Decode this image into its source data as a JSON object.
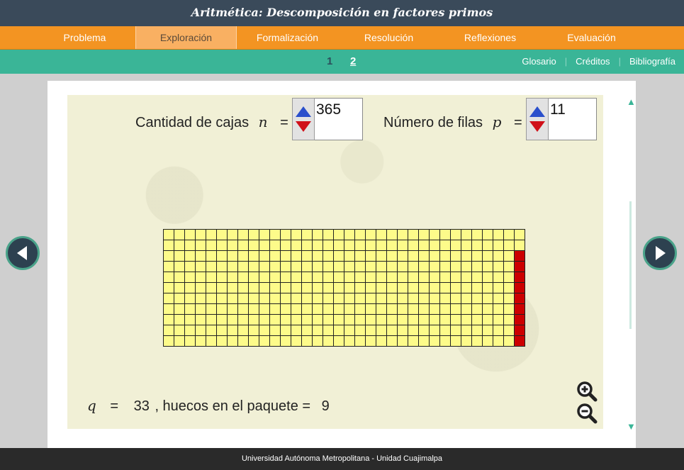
{
  "header": {
    "title": "Aritmética: Descomposición en factores primos"
  },
  "main_nav": {
    "tabs": [
      {
        "label": "Problema",
        "active": false
      },
      {
        "label": "Exploración",
        "active": true
      },
      {
        "label": "Formalización",
        "active": false
      },
      {
        "label": "Resolución",
        "active": false
      },
      {
        "label": "Reflexiones",
        "active": false
      },
      {
        "label": "Evaluación",
        "active": false
      }
    ]
  },
  "sub_nav": {
    "pages": [
      {
        "label": "1",
        "current": false
      },
      {
        "label": "2",
        "current": true
      }
    ],
    "links": [
      "Glosario",
      "Créditos",
      "Bibliografía"
    ]
  },
  "exploration": {
    "n_label": "Cantidad de cajas",
    "n_var": "n",
    "n_value": "365",
    "p_label": "Número de filas",
    "p_var": "p",
    "p_value": "11",
    "equals": "=",
    "q_var": "q",
    "q_value": "33",
    "gaps_label": ", huecos en el paquete =",
    "gaps_value": "9"
  },
  "grid": {
    "rows": 11,
    "full_columns": 33,
    "last_column_filled": 2,
    "fill_color": "#fdfb8a",
    "last_color": "#cc0000",
    "gap_color": "#cc0000"
  },
  "icons": {
    "zoom_in": "zoom-in-icon",
    "zoom_out": "zoom-out-icon",
    "prev": "arrow-left-icon",
    "next": "arrow-right-icon"
  },
  "footer": {
    "text": "Universidad Autónoma Metropolitana - Unidad Cuajimalpa"
  }
}
